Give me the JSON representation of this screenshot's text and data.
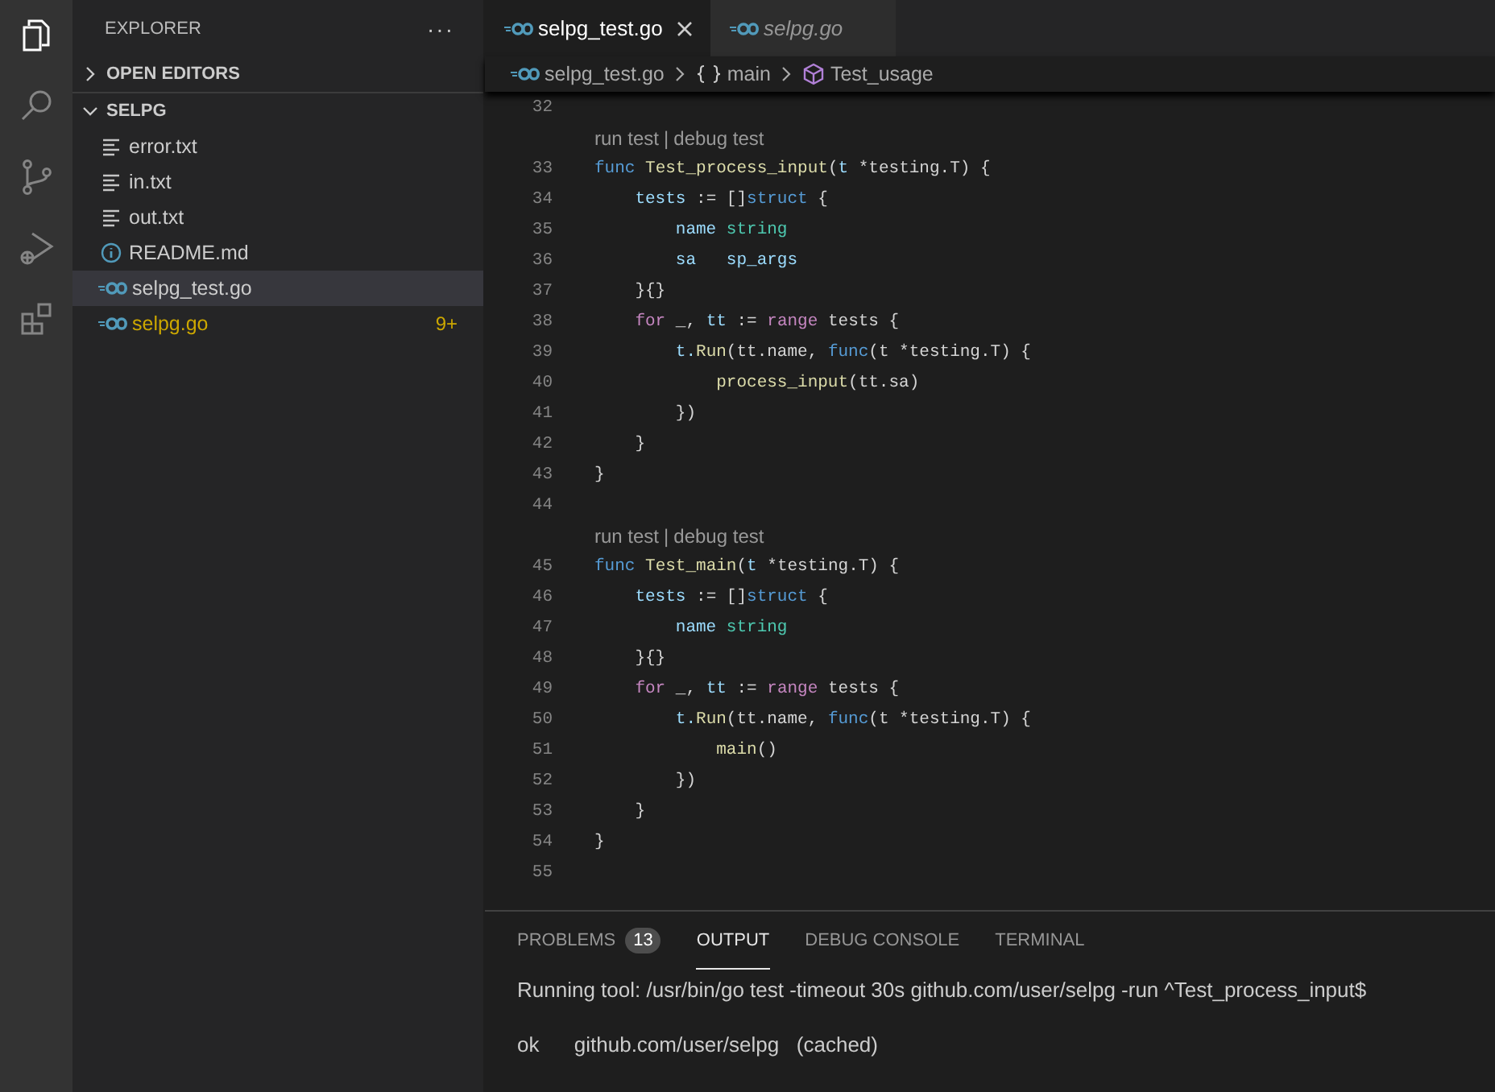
{
  "activity_bar": [
    {
      "kind": "files",
      "selected": true
    },
    {
      "kind": "search",
      "selected": false
    },
    {
      "kind": "source-control",
      "selected": false
    },
    {
      "kind": "run-debug",
      "selected": false
    },
    {
      "kind": "extensions",
      "selected": false
    }
  ],
  "sidebar": {
    "title": "EXPLORER",
    "more": "···",
    "sections": [
      {
        "label": "OPEN EDITORS",
        "expanded": false
      },
      {
        "label": "SELPG",
        "expanded": true,
        "children": [
          {
            "name": "error.txt",
            "kind": "text",
            "selected": false
          },
          {
            "name": "in.txt",
            "kind": "text",
            "selected": false
          },
          {
            "name": "out.txt",
            "kind": "text",
            "selected": false
          },
          {
            "name": "README.md",
            "kind": "info",
            "selected": false
          },
          {
            "name": "selpg_test.go",
            "kind": "go",
            "selected": true
          },
          {
            "name": "selpg.go",
            "kind": "go",
            "selected": false,
            "color": "#cca700",
            "badge": "9+"
          }
        ]
      }
    ]
  },
  "tabs": [
    {
      "label": "selpg_test.go",
      "selected": true,
      "preview": false
    },
    {
      "label": "selpg.go",
      "selected": false,
      "preview": true
    }
  ],
  "breadcrumb": [
    {
      "kind": "go",
      "label": "selpg_test.go"
    },
    {
      "kind": "namespace",
      "label": "main"
    },
    {
      "kind": "struct",
      "label": "Test_usage"
    }
  ],
  "code": [
    {
      "kind": "line",
      "number": "32"
    },
    {
      "kind": "codelens",
      "links": [
        "run test",
        "debug test"
      ],
      "separator": "|"
    },
    {
      "kind": "line",
      "number": "33",
      "tokens": [
        {
          "text": "func ",
          "kind": "keyword"
        },
        {
          "text": "Test_process_input",
          "kind": "function"
        },
        {
          "text": "(",
          "kind": "plain"
        },
        {
          "text": "t ",
          "kind": "variable"
        },
        {
          "text": "*testing.T) {",
          "kind": "plain"
        }
      ]
    },
    {
      "kind": "line",
      "number": "34",
      "tokens": [
        {
          "text": "    tests",
          "kind": "variable"
        },
        {
          "text": " := []",
          "kind": "plain"
        },
        {
          "text": "struct",
          "kind": "keyword"
        },
        {
          "text": " {",
          "kind": "plain"
        }
      ]
    },
    {
      "kind": "line",
      "number": "35",
      "tokens": [
        {
          "text": "        name ",
          "kind": "variable"
        },
        {
          "text": "string",
          "kind": "type"
        }
      ]
    },
    {
      "kind": "line",
      "number": "36",
      "tokens": [
        {
          "text": "        sa   sp_args",
          "kind": "variable"
        }
      ]
    },
    {
      "kind": "line",
      "number": "37",
      "tokens": [
        {
          "text": "    }{}",
          "kind": "plain"
        }
      ]
    },
    {
      "kind": "line",
      "number": "38",
      "tokens": [
        {
          "text": "    for",
          "kind": "control"
        },
        {
          "text": " _, ",
          "kind": "plain"
        },
        {
          "text": "tt",
          "kind": "variable"
        },
        {
          "text": " := ",
          "kind": "plain"
        },
        {
          "text": "range",
          "kind": "control"
        },
        {
          "text": " tests {",
          "kind": "plain"
        }
      ]
    },
    {
      "kind": "line",
      "number": "39",
      "tokens": [
        {
          "text": "        t.",
          "kind": "variable"
        },
        {
          "text": "Run",
          "kind": "function"
        },
        {
          "text": "(tt.name, ",
          "kind": "plain"
        },
        {
          "text": "func",
          "kind": "keyword"
        },
        {
          "text": "(t *testing.T) {",
          "kind": "plain"
        }
      ]
    },
    {
      "kind": "line",
      "number": "40",
      "tokens": [
        {
          "text": "            process_input",
          "kind": "function"
        },
        {
          "text": "(tt.sa)",
          "kind": "plain"
        }
      ]
    },
    {
      "kind": "line",
      "number": "41",
      "tokens": [
        {
          "text": "        })",
          "kind": "plain"
        }
      ]
    },
    {
      "kind": "line",
      "number": "42",
      "tokens": [
        {
          "text": "    }",
          "kind": "plain"
        }
      ]
    },
    {
      "kind": "line",
      "number": "43",
      "tokens": [
        {
          "text": "}",
          "kind": "plain"
        }
      ]
    },
    {
      "kind": "line",
      "number": "44"
    },
    {
      "kind": "codelens",
      "links": [
        "run test",
        "debug test"
      ],
      "separator": "|"
    },
    {
      "kind": "line",
      "number": "45",
      "tokens": [
        {
          "text": "func ",
          "kind": "keyword"
        },
        {
          "text": "Test_main",
          "kind": "function"
        },
        {
          "text": "(",
          "kind": "plain"
        },
        {
          "text": "t ",
          "kind": "variable"
        },
        {
          "text": "*testing.T) {",
          "kind": "plain"
        }
      ]
    },
    {
      "kind": "line",
      "number": "46",
      "tokens": [
        {
          "text": "    tests",
          "kind": "variable"
        },
        {
          "text": " := []",
          "kind": "plain"
        },
        {
          "text": "struct",
          "kind": "keyword"
        },
        {
          "text": " {",
          "kind": "plain"
        }
      ]
    },
    {
      "kind": "line",
      "number": "47",
      "tokens": [
        {
          "text": "        name ",
          "kind": "variable"
        },
        {
          "text": "string",
          "kind": "type"
        }
      ]
    },
    {
      "kind": "line",
      "number": "48",
      "tokens": [
        {
          "text": "    }{}",
          "kind": "plain"
        }
      ]
    },
    {
      "kind": "line",
      "number": "49",
      "tokens": [
        {
          "text": "    for",
          "kind": "control"
        },
        {
          "text": " _, ",
          "kind": "plain"
        },
        {
          "text": "tt",
          "kind": "variable"
        },
        {
          "text": " := ",
          "kind": "plain"
        },
        {
          "text": "range",
          "kind": "control"
        },
        {
          "text": " tests {",
          "kind": "plain"
        }
      ]
    },
    {
      "kind": "line",
      "number": "50",
      "tokens": [
        {
          "text": "        t.",
          "kind": "variable"
        },
        {
          "text": "Run",
          "kind": "function"
        },
        {
          "text": "(tt.name, ",
          "kind": "plain"
        },
        {
          "text": "func",
          "kind": "keyword"
        },
        {
          "text": "(t *testing.T) {",
          "kind": "plain"
        }
      ]
    },
    {
      "kind": "line",
      "number": "51",
      "tokens": [
        {
          "text": "            main",
          "kind": "function"
        },
        {
          "text": "()",
          "kind": "plain"
        }
      ]
    },
    {
      "kind": "line",
      "number": "52",
      "tokens": [
        {
          "text": "        })",
          "kind": "plain"
        }
      ]
    },
    {
      "kind": "line",
      "number": "53",
      "tokens": [
        {
          "text": "    }",
          "kind": "plain"
        }
      ]
    },
    {
      "kind": "line",
      "number": "54",
      "tokens": [
        {
          "text": "}",
          "kind": "plain"
        }
      ]
    },
    {
      "kind": "line",
      "number": "55"
    }
  ],
  "panel": {
    "tabs": [
      {
        "label": "PROBLEMS",
        "badge": "13",
        "selected": false
      },
      {
        "label": "OUTPUT",
        "selected": true
      },
      {
        "label": "DEBUG CONSOLE",
        "selected": false
      },
      {
        "label": "TERMINAL",
        "selected": false
      }
    ],
    "output": [
      "Running tool: /usr/bin/go test -timeout 30s github.com/user/selpg -run ^Test_process_input$",
      "ok      github.com/user/selpg   (cached)"
    ]
  }
}
